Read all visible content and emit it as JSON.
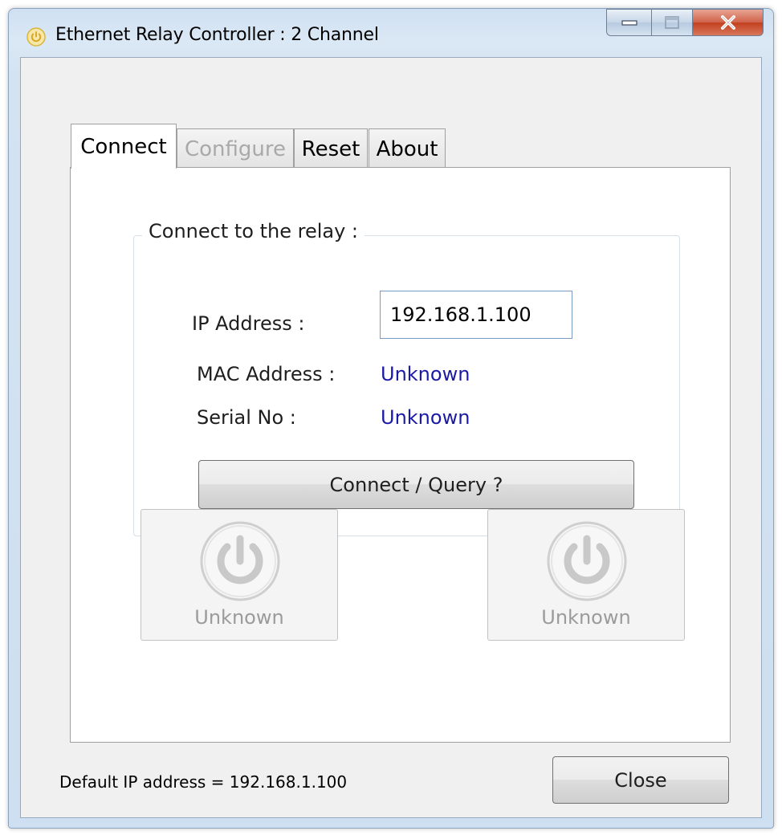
{
  "window": {
    "title": "Ethernet Relay Controller : 2 Channel",
    "icon": "power-icon",
    "caption_buttons": [
      "minimize",
      "maximize",
      "close"
    ]
  },
  "tabs": [
    {
      "label": "Connect",
      "active": true,
      "enabled": true
    },
    {
      "label": "Configure",
      "active": false,
      "enabled": false
    },
    {
      "label": "Reset",
      "active": false,
      "enabled": true
    },
    {
      "label": "About",
      "active": false,
      "enabled": true
    }
  ],
  "connect_group": {
    "title": "Connect to the relay :",
    "ip_label": "IP Address :",
    "ip_value": "192.168.1.100",
    "mac_label": "MAC Address :",
    "mac_value": "Unknown",
    "serial_label": "Serial No :",
    "serial_value": "Unknown",
    "connect_button": "Connect / Query ?"
  },
  "relays": [
    {
      "label": "Unknown",
      "icon": "power-icon",
      "state": "disabled"
    },
    {
      "label": "Unknown",
      "icon": "power-icon",
      "state": "disabled"
    }
  ],
  "footer": {
    "status": "Default IP address = 192.168.1.100",
    "close_button": "Close"
  },
  "colors": {
    "value_text": "#1a1aa6",
    "disabled_text": "#9b9b9b",
    "close_caption": "#c2401f"
  }
}
